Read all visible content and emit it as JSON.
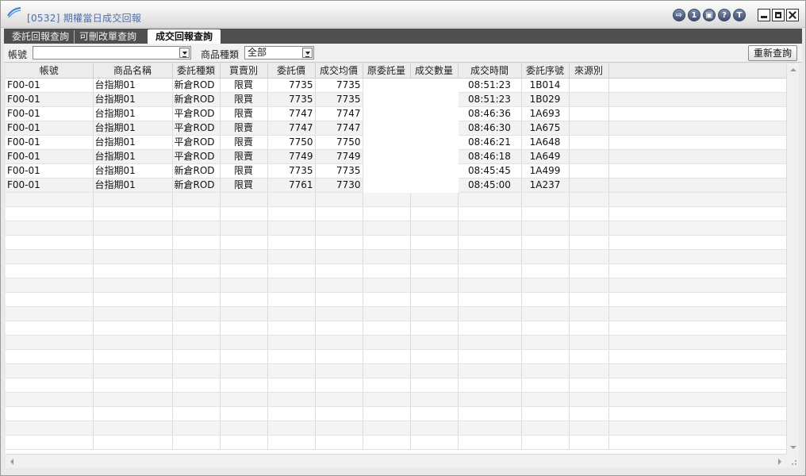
{
  "window": {
    "title": "[0532] 期權當日成交回報",
    "buttons": {
      "b1": "⇨",
      "b2": "1",
      "b3": "▣",
      "b4": "?",
      "b5": "T"
    }
  },
  "tabs": [
    {
      "label": "委託回報查詢"
    },
    {
      "label": "可刪改單查詢"
    },
    {
      "label": "成交回報查詢"
    }
  ],
  "filters": {
    "account_label": "帳號",
    "account_value": "",
    "product_type_label": "商品種類",
    "product_type_value": "全部",
    "requery_label": "重新查詢"
  },
  "colors": {
    "buy": "#c62828",
    "sell": "#5b5fa8"
  },
  "grid": {
    "columns": [
      "帳號",
      "商品名稱",
      "委託種類",
      "買賣別",
      "委託價",
      "成交均價",
      "原委託量",
      "成交數量",
      "成交時間",
      "委託序號",
      "來源別"
    ],
    "rows": [
      {
        "account": "F00-01",
        "product": "台指期01",
        "order_type": "新倉ROD",
        "side": "限買",
        "order_price": "7735",
        "avg_price": "7735",
        "time": "08:51:23",
        "seq": "1B014"
      },
      {
        "account": "F00-01",
        "product": "台指期01",
        "order_type": "新倉ROD",
        "side": "限買",
        "order_price": "7735",
        "avg_price": "7735",
        "time": "08:51:23",
        "seq": "1B029"
      },
      {
        "account": "F00-01",
        "product": "台指期01",
        "order_type": "平倉ROD",
        "side": "限賣",
        "order_price": "7747",
        "avg_price": "7747",
        "time": "08:46:36",
        "seq": "1A693"
      },
      {
        "account": "F00-01",
        "product": "台指期01",
        "order_type": "平倉ROD",
        "side": "限賣",
        "order_price": "7747",
        "avg_price": "7747",
        "time": "08:46:30",
        "seq": "1A675"
      },
      {
        "account": "F00-01",
        "product": "台指期01",
        "order_type": "平倉ROD",
        "side": "限賣",
        "order_price": "7750",
        "avg_price": "7750",
        "time": "08:46:21",
        "seq": "1A648"
      },
      {
        "account": "F00-01",
        "product": "台指期01",
        "order_type": "平倉ROD",
        "side": "限賣",
        "order_price": "7749",
        "avg_price": "7749",
        "time": "08:46:18",
        "seq": "1A649"
      },
      {
        "account": "F00-01",
        "product": "台指期01",
        "order_type": "新倉ROD",
        "side": "限買",
        "order_price": "7735",
        "avg_price": "7735",
        "time": "08:45:45",
        "seq": "1A499"
      },
      {
        "account": "F00-01",
        "product": "台指期01",
        "order_type": "新倉ROD",
        "side": "限買",
        "order_price": "7761",
        "avg_price": "7730",
        "time": "08:45:00",
        "seq": "1A237"
      }
    ]
  }
}
